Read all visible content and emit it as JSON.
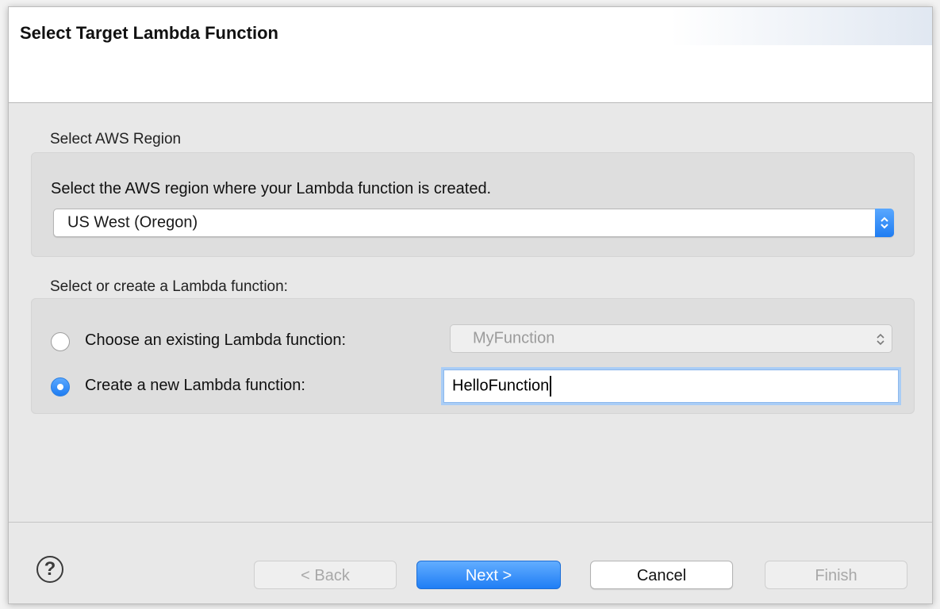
{
  "header": {
    "title": "Select Target Lambda Function"
  },
  "region_group": {
    "label": "Select AWS Region",
    "description": "Select the AWS region where your Lambda function is created.",
    "selected_region": "US West (Oregon)"
  },
  "function_group": {
    "label": "Select or create a Lambda function:",
    "existing": {
      "label": "Choose an existing Lambda function:",
      "selected": false,
      "value": "MyFunction"
    },
    "create_new": {
      "label": "Create a new Lambda function:",
      "selected": true,
      "value": "HelloFunction"
    }
  },
  "footer": {
    "help_glyph": "?",
    "back_label": "< Back",
    "next_label": "Next >",
    "cancel_label": "Cancel",
    "finish_label": "Finish"
  },
  "colors": {
    "accent": "#1f7ef5",
    "focus_ring": "#a9cdf6"
  },
  "icons": {
    "help": "help-icon",
    "stepper": "updown-chevron-icon"
  }
}
